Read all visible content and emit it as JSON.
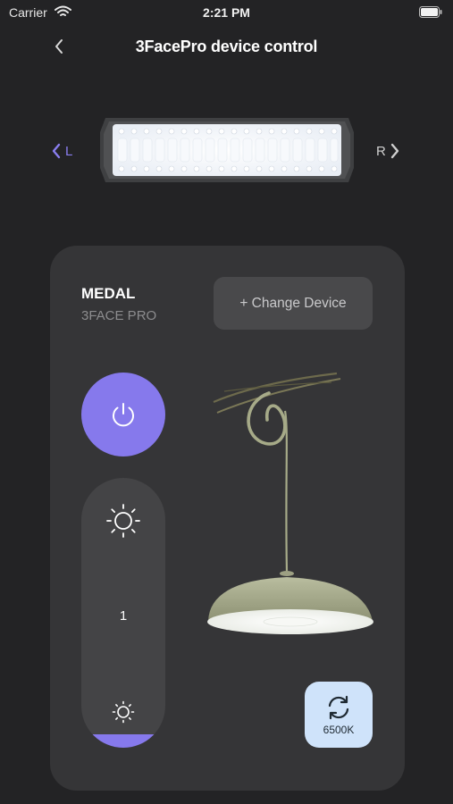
{
  "status_bar": {
    "carrier": "Carrier",
    "time": "2:21 PM"
  },
  "header": {
    "title": "3FacePro device control",
    "back_icon": "chevron-left-icon"
  },
  "side_selector": {
    "left_label": "L",
    "right_label": "R",
    "active": "L",
    "active_color": "#8679ec"
  },
  "device_card": {
    "name": "MEDAL",
    "model": "3FACE PRO",
    "change_device_label": "+ Change Device",
    "power": {
      "state": "on",
      "icon": "power-icon"
    },
    "brightness": {
      "value": "1",
      "fill_fraction": 0.05,
      "icon": "sun-icon"
    },
    "color_temperature": {
      "label": "6500K",
      "icon": "refresh-icon"
    }
  },
  "colors": {
    "background": "#232325",
    "card": "#353537",
    "accent": "#8679ec",
    "cct_button": "#cfe3fa"
  }
}
